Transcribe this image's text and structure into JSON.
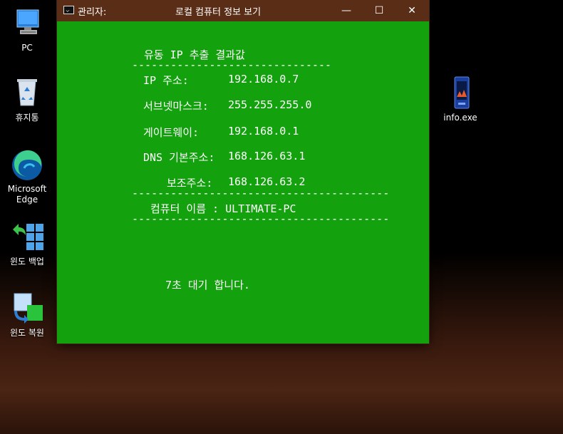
{
  "desktop": {
    "icons": [
      {
        "label": "PC"
      },
      {
        "label": "휴지통"
      },
      {
        "label_line1": "Microsoft",
        "label_line2": "Edge"
      },
      {
        "label": "윈도 백업"
      },
      {
        "label": "윈도 복원"
      },
      {
        "label": "info.exe"
      }
    ]
  },
  "window": {
    "admin_label": "관리자:",
    "title": "로컬 컴퓨터 정보 보기",
    "minimize": "—",
    "maximize": "☐",
    "close": "✕"
  },
  "console": {
    "heading": "유동 IP 추출 결과값",
    "dash_short": "-----------------------------------",
    "dash_long": "------------------------------------------------------------",
    "rows": [
      {
        "label": "IP 주소:",
        "value": "192.168.0.7"
      },
      {
        "label": "서브넷마스크:",
        "value": "255.255.255.0"
      },
      {
        "label": "게이트웨이:",
        "value": "192.168.0.1"
      },
      {
        "label": "DNS 기본주소:",
        "value": "168.126.63.1"
      },
      {
        "label": "보조주소:",
        "value": "168.126.63.2"
      }
    ],
    "computer_name": "컴퓨터 이름 : ULTIMATE-PC",
    "wait_message": "7초 대기 합니다."
  }
}
